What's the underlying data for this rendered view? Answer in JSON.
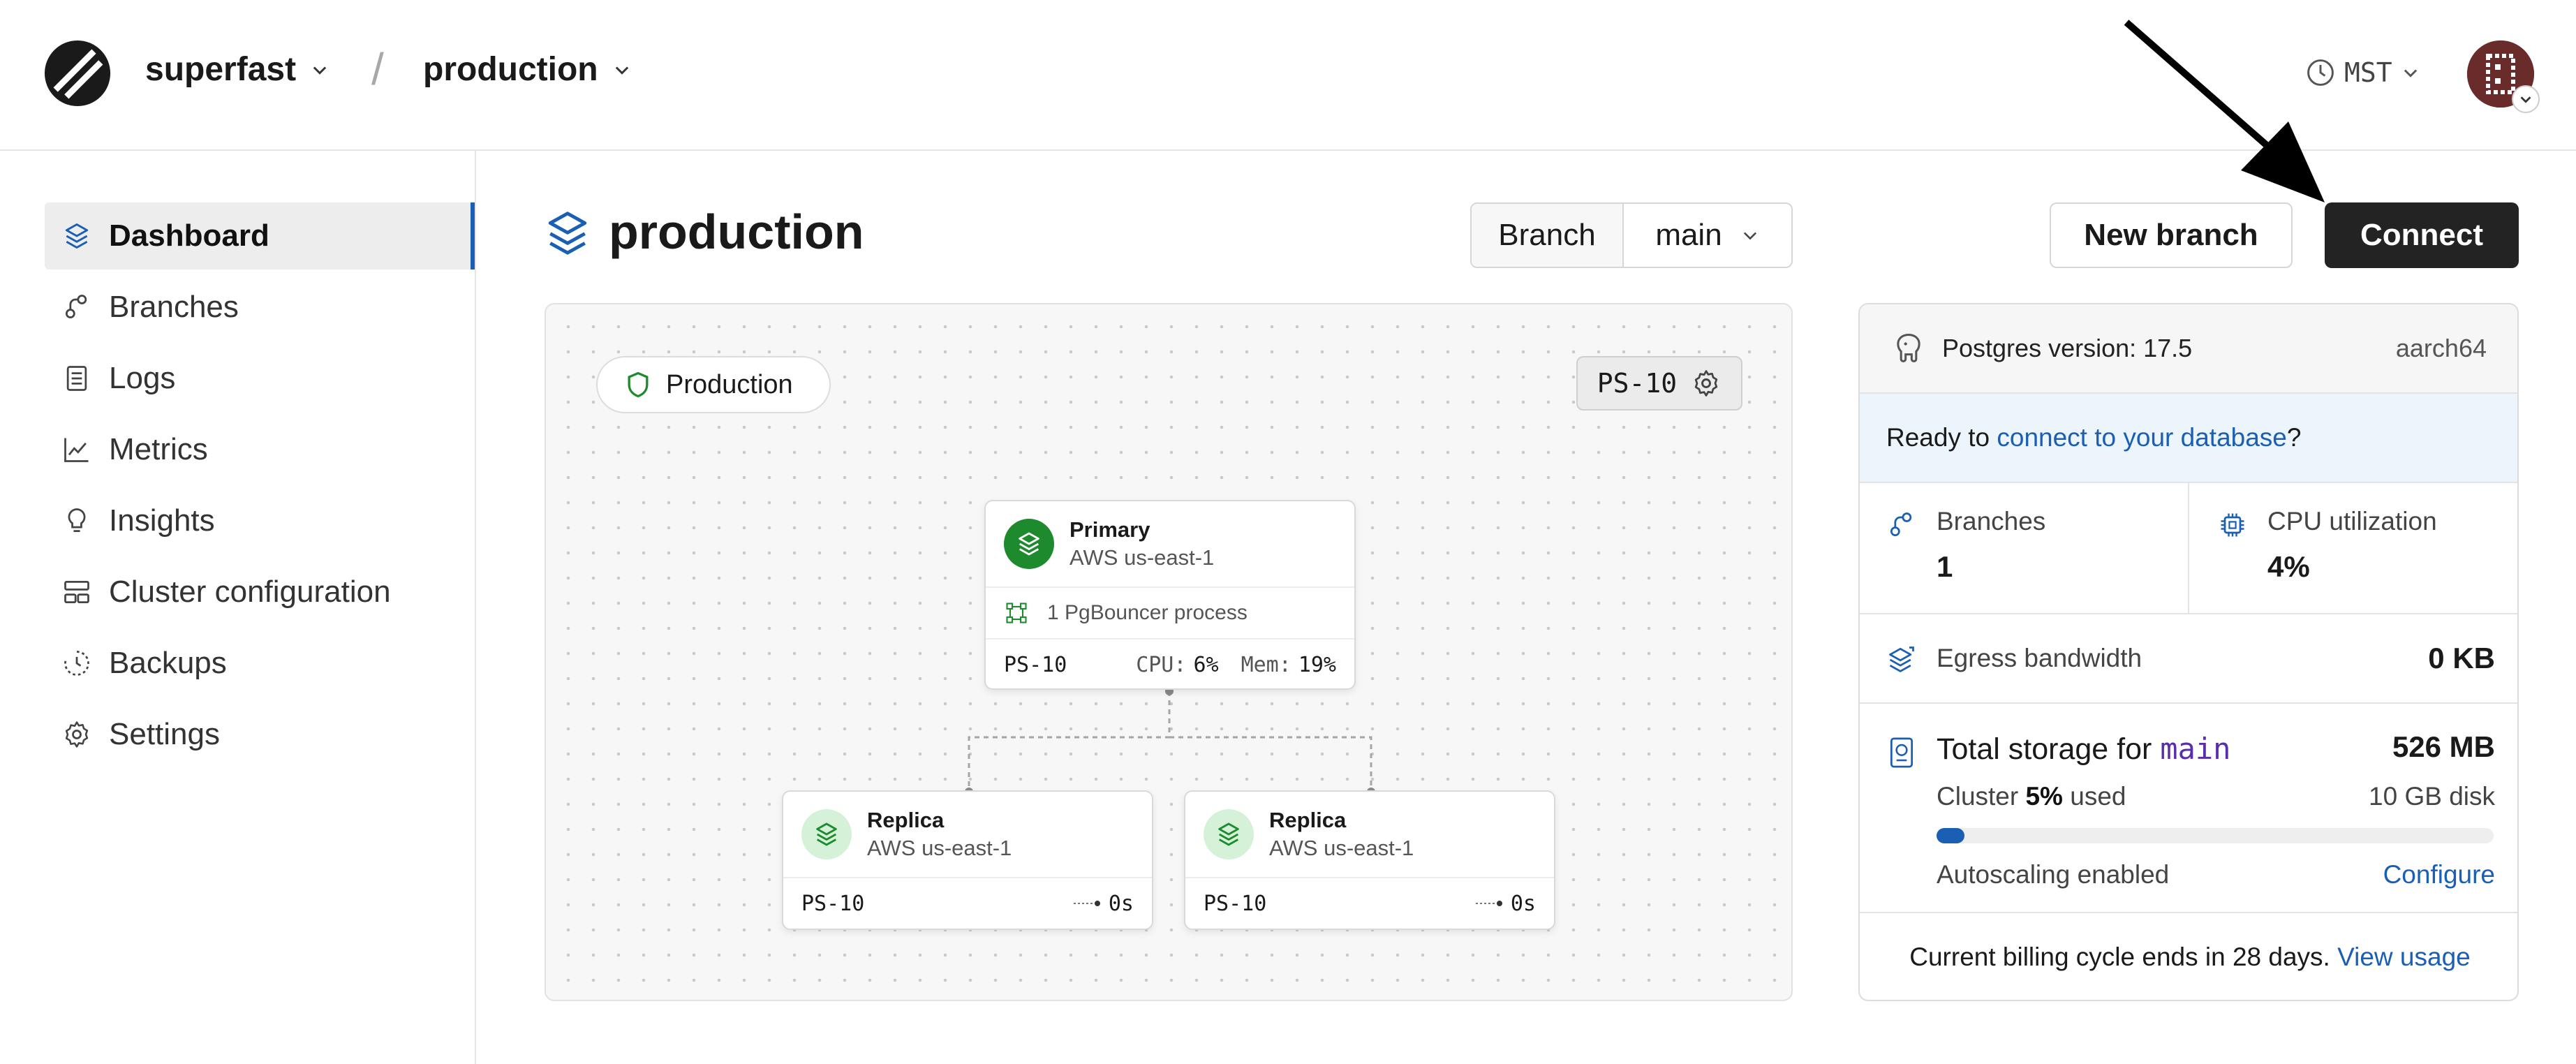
{
  "header": {
    "org": "superfast",
    "separator": "/",
    "database": "production",
    "timezone": "MST"
  },
  "sidebar": {
    "items": [
      {
        "label": "Dashboard",
        "icon": "stack-icon",
        "active": true
      },
      {
        "label": "Branches",
        "icon": "branches-icon"
      },
      {
        "label": "Logs",
        "icon": "logs-icon"
      },
      {
        "label": "Metrics",
        "icon": "metrics-icon"
      },
      {
        "label": "Insights",
        "icon": "lightbulb-icon"
      },
      {
        "label": "Cluster configuration",
        "icon": "cluster-icon"
      },
      {
        "label": "Backups",
        "icon": "backup-icon"
      },
      {
        "label": "Settings",
        "icon": "gear-icon"
      }
    ]
  },
  "main": {
    "title": "production",
    "branch_label": "Branch",
    "branch_value": "main",
    "new_branch": "New branch",
    "connect": "Connect"
  },
  "canvas": {
    "environment": "Production",
    "cluster_size": "PS-10",
    "primary": {
      "name": "Primary",
      "region": "AWS us-east-1",
      "pgbouncer": "1 PgBouncer process",
      "size": "PS-10",
      "cpu_label": "CPU:",
      "cpu_value": "6%",
      "mem_label": "Mem:",
      "mem_value": "19%"
    },
    "replicas": [
      {
        "name": "Replica",
        "region": "AWS us-east-1",
        "size": "PS-10",
        "lag": "0s"
      },
      {
        "name": "Replica",
        "region": "AWS us-east-1",
        "size": "PS-10",
        "lag": "0s"
      }
    ]
  },
  "panel": {
    "postgres_label": "Postgres version: 17.5",
    "arch": "aarch64",
    "ready_prefix": "Ready to ",
    "ready_link": "connect to your database",
    "ready_suffix": "?",
    "branches_label": "Branches",
    "branches_value": "1",
    "cpu_label": "CPU utilization",
    "cpu_value": "4%",
    "egress_label": "Egress bandwidth",
    "egress_value": "0 KB",
    "storage_prefix": "Total storage for ",
    "storage_branch": "main",
    "storage_value": "526 MB",
    "cluster_prefix": "Cluster ",
    "cluster_pct": "5%",
    "cluster_suffix": " used",
    "disk": "10 GB disk",
    "usage_fraction": 0.05,
    "autoscaling": "Autoscaling enabled",
    "configure": "Configure",
    "billing_text": "Current billing cycle ends in 28 days. ",
    "view_usage": "View usage"
  },
  "colors": {
    "accent": "#1a5fb4",
    "primary_green": "#1e8a2e",
    "replica_green": "#d5f2d8",
    "connect_bg": "#232323"
  }
}
